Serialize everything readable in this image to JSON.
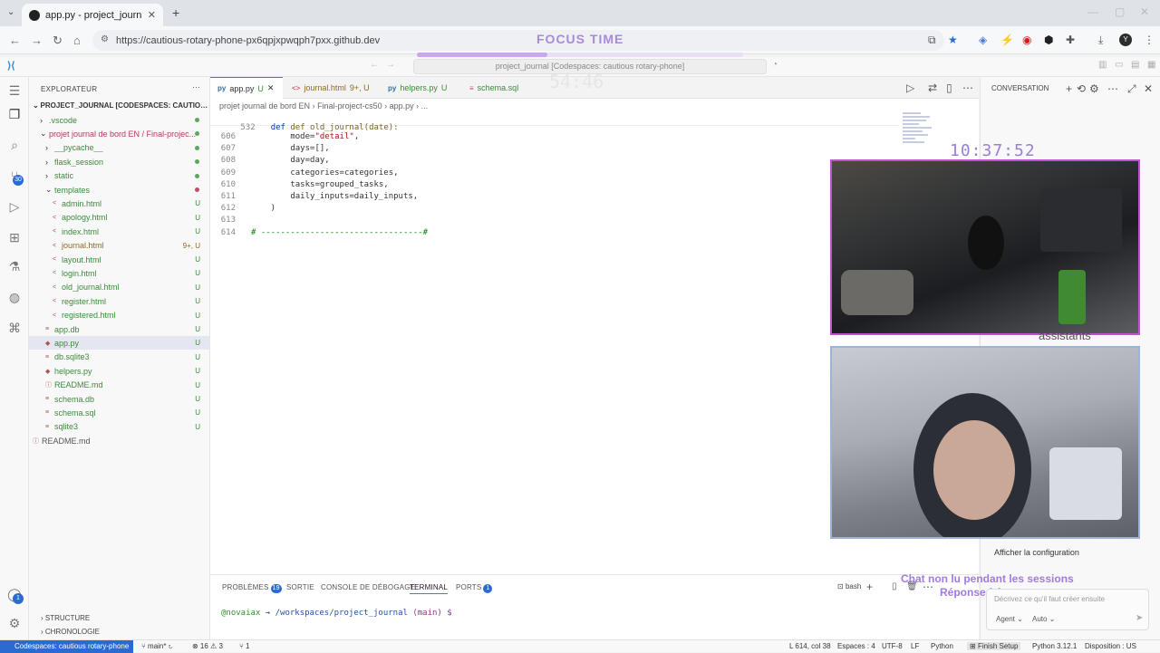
{
  "browser": {
    "tab_title": "app.py - project_journal [Codes",
    "url": "https://cautious-rotary-phone-px6qpjxpwqph7pxx.github.dev",
    "focus_label": "FOCUS TIME",
    "focus_progress": 0.4,
    "profile_initial": "Y"
  },
  "vscode": {
    "command_center": "project_journal [Codespaces: cautious rotary-phone]",
    "activity_badges": {
      "source_control": "30",
      "accounts": "1"
    }
  },
  "explorer": {
    "title": "EXPLORATEUR",
    "root": "PROJECT_JOURNAL [CODESPACES: CAUTIOUS ROTA...",
    "items": [
      {
        "label": ".vscode",
        "status": ""
      },
      {
        "label": "projet journal de bord EN / Final-projec...",
        "status": ""
      },
      {
        "label": "__pycache__",
        "status": ""
      },
      {
        "label": "flask_session",
        "status": ""
      },
      {
        "label": "static",
        "status": ""
      },
      {
        "label": "templates",
        "status": ""
      },
      {
        "label": "admin.html",
        "status": "U"
      },
      {
        "label": "apology.html",
        "status": "U"
      },
      {
        "label": "index.html",
        "status": "U"
      },
      {
        "label": "journal.html",
        "status": "9+, U"
      },
      {
        "label": "layout.html",
        "status": "U"
      },
      {
        "label": "login.html",
        "status": "U"
      },
      {
        "label": "old_journal.html",
        "status": "U"
      },
      {
        "label": "register.html",
        "status": "U"
      },
      {
        "label": "registered.html",
        "status": "U"
      },
      {
        "label": "app.db",
        "status": "U"
      },
      {
        "label": "app.py",
        "status": "U"
      },
      {
        "label": "db.sqlite3",
        "status": "U"
      },
      {
        "label": "helpers.py",
        "status": "U"
      },
      {
        "label": "README.md",
        "status": "U"
      },
      {
        "label": "schema.db",
        "status": "U"
      },
      {
        "label": "schema.sql",
        "status": "U"
      },
      {
        "label": "sqlite3",
        "status": "U"
      },
      {
        "label": "README.md",
        "status": ""
      }
    ],
    "bottom": [
      "STRUCTURE",
      "CHRONOLOGIE"
    ]
  },
  "editor": {
    "tabs": [
      {
        "label": "app.py",
        "status": "U"
      },
      {
        "label": "journal.html",
        "status": "9+, U"
      },
      {
        "label": "helpers.py",
        "status": "U"
      },
      {
        "label": "schema.sql",
        "status": ""
      }
    ],
    "breadcrumbs": [
      "projet journal de bord EN",
      "Final-project-cs50",
      "app.py",
      "..."
    ],
    "sticky": {
      "num": "532",
      "text": "def old_journal(date):"
    },
    "lines": [
      {
        "num": "606",
        "text": "        mode=\"detail\","
      },
      {
        "num": "607",
        "text": "        days=[],"
      },
      {
        "num": "608",
        "text": "        day=day,"
      },
      {
        "num": "609",
        "text": "        categories=categories,"
      },
      {
        "num": "610",
        "text": "        tasks=grouped_tasks,"
      },
      {
        "num": "611",
        "text": "        daily_inputs=daily_inputs,"
      },
      {
        "num": "612",
        "text": "    )"
      },
      {
        "num": "613",
        "text": ""
      },
      {
        "num": "614",
        "text": "# ---------------------------------#"
      }
    ]
  },
  "panel": {
    "tabs": [
      "PROBLÈMES",
      "SORTIE",
      "CONSOLE DE DÉBOGAGE",
      "TERMINAL",
      "PORTS"
    ],
    "problems_count": "19",
    "ports_count": "1",
    "shell": "bash",
    "prompt_user": "@novaiax",
    "prompt_path": "→ /workspaces/project_journal",
    "prompt_branch": "(main) $"
  },
  "chat": {
    "title": "CONVERSATION",
    "show_config": "Afficher la configuration",
    "placeholder": "Décrivez ce qu'il faut créer ensuite",
    "agent": "Agent",
    "auto": "Auto"
  },
  "overlay": {
    "clock": "10:37:52",
    "timer_ghost": "54:46",
    "assistants": "assistants",
    "chat_notice_1": "Chat non lu pendant les sessions",
    "chat_notice_2": "Réponse à la pause"
  },
  "statusbar": {
    "remote": "Codespaces: cautious rotary-phone",
    "branch": "main*",
    "errors": "⊗ 16 ⚠ 3",
    "ports": "⑂ 1",
    "position": "L 614, col 38",
    "spaces": "Espaces : 4",
    "encoding": "UTF-8",
    "eol": "LF",
    "language": "Python",
    "finish": "Finish Setup",
    "interpreter": "Python 3.12.1",
    "layout": "Disposition : US"
  }
}
